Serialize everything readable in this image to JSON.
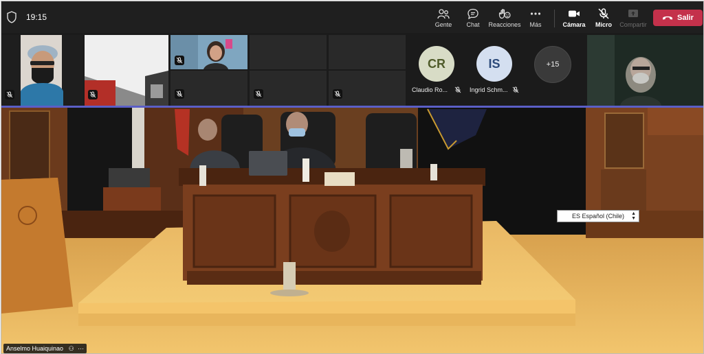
{
  "header": {
    "time": "19:15",
    "buttons": {
      "people": "Gente",
      "chat": "Chat",
      "reactions": "Reacciones",
      "more": "Más",
      "camera": "Cámara",
      "mic": "Micro",
      "share": "Compartir",
      "leave": "Salir"
    }
  },
  "participants": [
    {
      "initials": "CR",
      "name": "Claudio Ro...",
      "color": "#d8dcc6",
      "text_color": "#4f5b2a"
    },
    {
      "initials": "IS",
      "name": "Ingrid Schm...",
      "color": "#d4dff0",
      "text_color": "#2c4a7a"
    }
  ],
  "overflow_count": "+15",
  "main": {
    "language_select": "ES Español (Chile)",
    "speaker_name": "Anselmo Huaiquinao"
  }
}
